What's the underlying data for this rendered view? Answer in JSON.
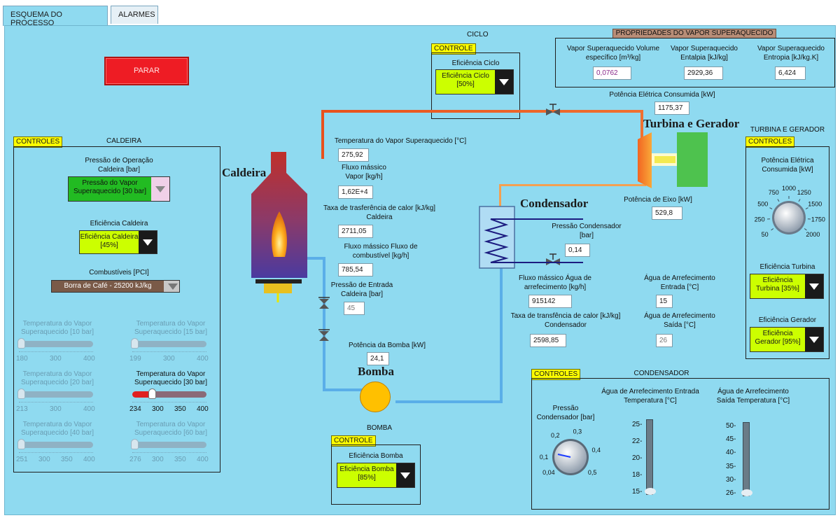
{
  "tabs": [
    {
      "label": "ESQUEMA DO PROCESSO"
    },
    {
      "label": "ALARMES"
    }
  ],
  "stop_button": "PARAR",
  "labels": {
    "ciclo": "CICLO",
    "caldeira_title": "CALDEIRA",
    "turbina_title": "TURBINA E GERADOR",
    "condensador_title": "CONDENSADOR",
    "bomba_title": "BOMBA",
    "big_caldeira": "Caldeira",
    "big_turbina": "Turbina e Gerador",
    "big_condensador": "Condensador",
    "big_bomba": "Bomba"
  },
  "controle": "CONTROLE",
  "controles": "CONTROLES",
  "ciclo": {
    "eff_label": "Eficiência Ciclo",
    "eff_value": "Eficiência Ciclo [50%]"
  },
  "propriedades": {
    "title": "PROPRIEDADES DO VAPOR SUPERAQUECIDO",
    "vol_label": "Vapor Superaquecido Volume específico [m³/kg]",
    "vol_value": "0,0762",
    "ent_label": "Vapor Superaquecido Entalpia [kJ/kg]",
    "ent_value": "2929,36",
    "entr_label": "Vapor Superaquecido Entropia [kJ/kg.K]",
    "entr_value": "6,424"
  },
  "potencia_eletrica": {
    "label": "Potência Elétrica Consumida [kW]",
    "value": "1175,37"
  },
  "process": {
    "temp_label": "Temperatura do Vapor Superaquecido [°C]",
    "temp_value": "275,92",
    "fluxo_vapor_label": "Fluxo mássico Vapor [kg/h]",
    "fluxo_vapor_value": "1,62E+4",
    "taxa_cald_label": "Taxa de trasferência de calor [kJ/kg] Caldeira",
    "taxa_cald_value": "2711,05",
    "fluxo_comb_label": "Fluxo mássico Fluxo de combustível [kg/h]",
    "fluxo_comb_value": "785,54",
    "pressao_entrada_label": "Pressão de Entrada Caldeira [bar]",
    "pressao_entrada_value": "45",
    "pot_bomba_label": "Potência da Bomba [kW]",
    "pot_bomba_value": "24,1",
    "pot_eixo_label": "Potência de Eixo [kW]",
    "pot_eixo_value": "529,8",
    "pressao_cond_label": "Pressão Condensador [bar]",
    "pressao_cond_value": "0,14",
    "fluxo_agua_label": "Fluxo mássico Água de arrefecimento [kg/h]",
    "fluxo_agua_value": "915142",
    "agua_entrada_label": "Água de Arrefecimento Entrada [°C]",
    "agua_entrada_value": "15",
    "taxa_cond_label": "Taxa de transfência de calor [kJ/kg] Condensador",
    "taxa_cond_value": "2598,85",
    "agua_saida_label": "Água de Arrefecimento Saída [°C]",
    "agua_saida_value": "26"
  },
  "caldeira": {
    "pressao_label": "Pressão de Operação Caldeira [bar]",
    "pressao_value": "Pressão do Vapor Superaquecido [30 bar]",
    "eff_label": "Eficiência Caldeira",
    "eff_value": "Eficiência Caldeira [45%]",
    "comb_label": "Combustíveis [PCI]",
    "comb_value": "Borra de Café - 25200 kJ/kg",
    "sliders": [
      {
        "label": "Temperatura do Vapor Superaquecido [10 bar]",
        "scale": [
          "180",
          "300",
          "400"
        ],
        "level": 0.0
      },
      {
        "label": "Temperatura do Vapor Superaquecido [15 bar]",
        "scale": [
          "199",
          "300",
          "400"
        ],
        "level": 0.0
      },
      {
        "label": "Temperatura do Vapor Superaquecido [20 bar]",
        "scale": [
          "213",
          "300",
          "400"
        ],
        "level": 0.0
      },
      {
        "label": "Temperatura do Vapor Superaquecido [30 bar]",
        "scale": [
          "234",
          "300",
          "350",
          "400"
        ],
        "level": 0.25
      },
      {
        "label": "Temperatura do Vapor Superaquecido [40 bar]",
        "scale": [
          "251",
          "300",
          "350",
          "400"
        ],
        "level": 0.0
      },
      {
        "label": "Temperatura do Vapor Superaquecido [60 bar]",
        "scale": [
          "276",
          "300",
          "350",
          "400"
        ],
        "level": 0.0
      }
    ]
  },
  "turbina": {
    "pot_label": "Potência Elétrica Consumida [kW]",
    "knob_scale": [
      "50",
      "250",
      "500",
      "750",
      "1000",
      "1250",
      "1500",
      "1750",
      "2000"
    ],
    "eff_turbina_label": "Eficiência Turbina",
    "eff_turbina_value": "Eficiência Turbina [35%]",
    "eff_gerador_label": "Eficiência Gerador",
    "eff_gerador_value": "Eficiência Gerador [95%]"
  },
  "bomba": {
    "eff_label": "Eficiência Bomba",
    "eff_value": "Eficiência Bomba [85%]"
  },
  "condensador": {
    "pressao_label": "Pressão Condensador [bar]",
    "knob_scale": [
      "0,04",
      "0,1",
      "0,2",
      "0,3",
      "0,4",
      "0,5"
    ],
    "entrada_label": "Água de Arrefecimento Entrada Temperatura [°C]",
    "entrada_scale": [
      "25",
      "22",
      "20",
      "18",
      "15"
    ],
    "saida_label": "Água de Arrefecimento Saída Temperatura [°C]",
    "saida_scale": [
      "50",
      "45",
      "40",
      "35",
      "30",
      "26"
    ]
  },
  "colors": {
    "panel": "#8fdaf0",
    "stop": "#ee1c24",
    "yellow_green": "#ccff00",
    "green": "#22bb22",
    "steam_pipe": "#e8511c",
    "water_pipe": "#5aaee8"
  }
}
